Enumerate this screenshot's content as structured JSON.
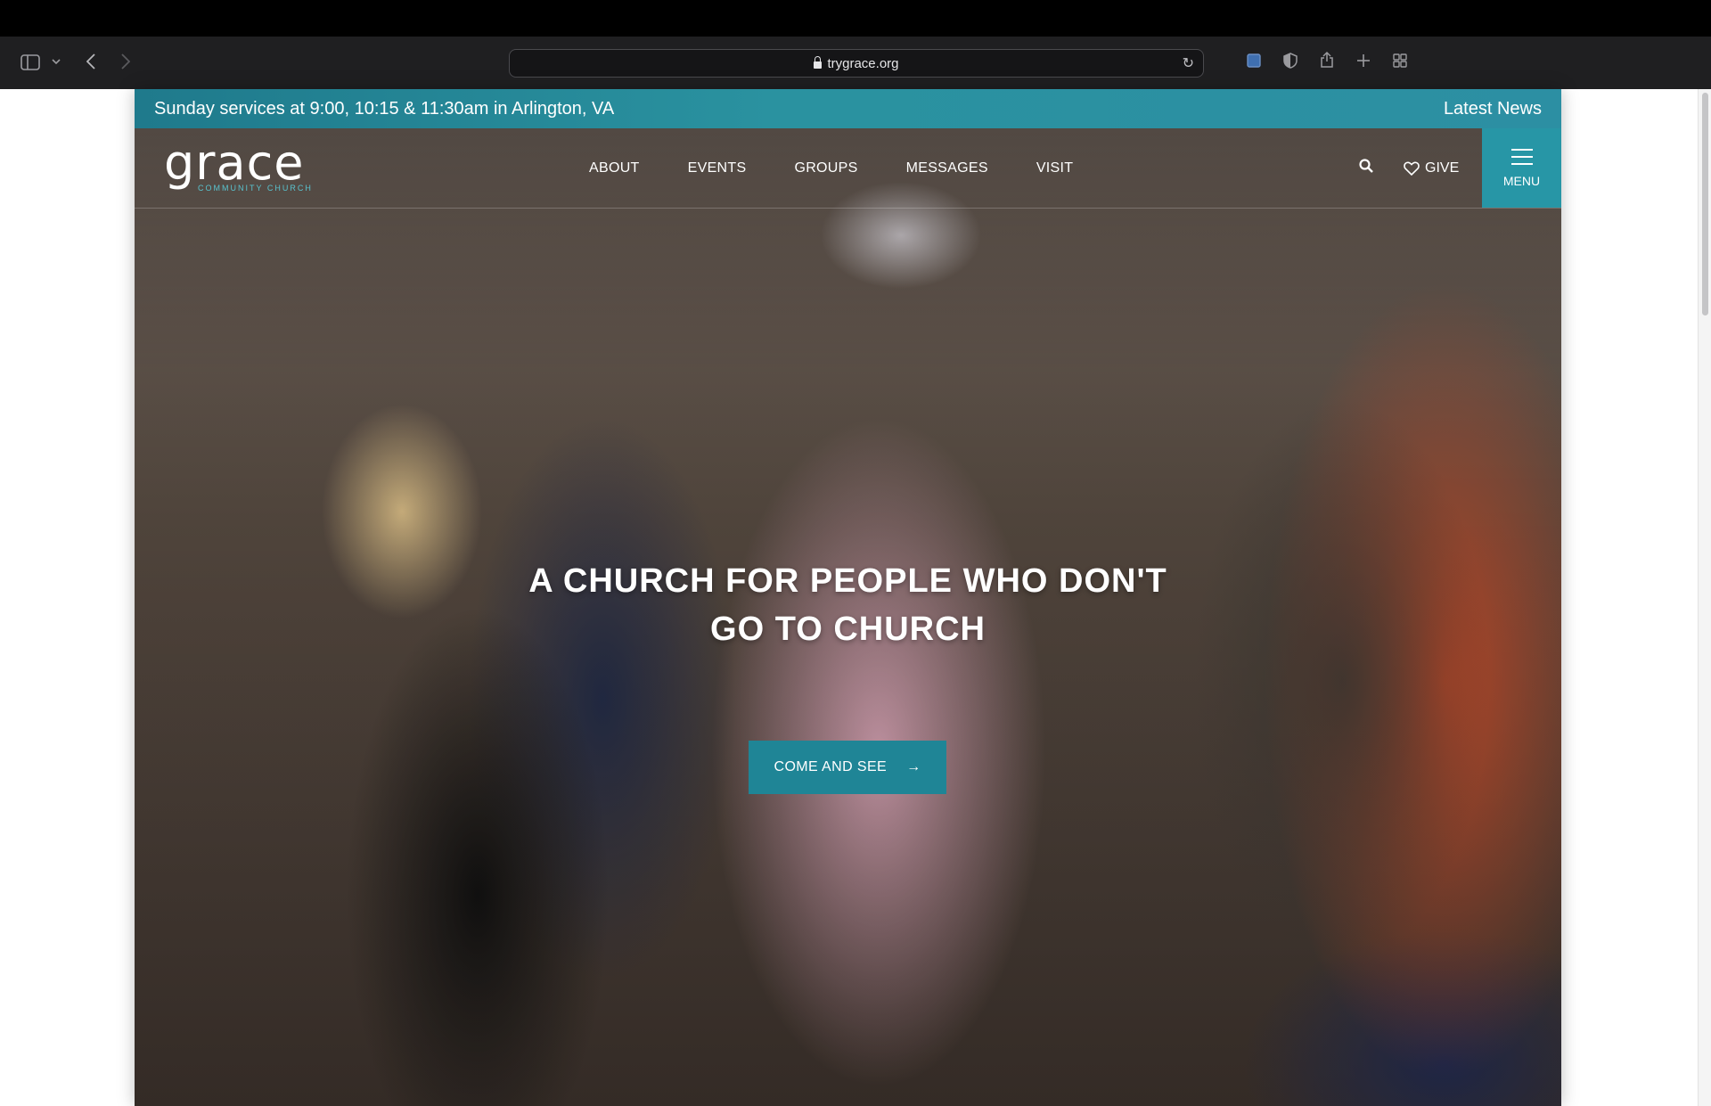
{
  "browser": {
    "url": "trygrace.org"
  },
  "announcement": {
    "services": "Sunday services at 9:00, 10:15 & 11:30am in Arlington, VA",
    "latest_news": "Latest News"
  },
  "site": {
    "logo_word": "grace",
    "logo_sub": "COMMUNITY CHURCH",
    "nav": [
      {
        "label": "ABOUT"
      },
      {
        "label": "EVENTS"
      },
      {
        "label": "GROUPS"
      },
      {
        "label": "MESSAGES"
      },
      {
        "label": "VISIT"
      }
    ],
    "give_label": "GIVE",
    "menu_label": "MENU"
  },
  "hero": {
    "headline_line1": "A CHURCH FOR PEOPLE WHO DON'T",
    "headline_line2": "GO TO CHURCH",
    "cta_label": "COME AND SEE",
    "cta_arrow": "→"
  },
  "colors": {
    "accent": "#2796a6",
    "cta": "#1f8596",
    "logo_sub": "#59c3cf"
  },
  "icons": [
    "sidebar-icon",
    "chevron-down-icon",
    "back-icon",
    "forward-icon",
    "lock-icon",
    "reload-icon",
    "tab-overview-icon",
    "privacy-icon",
    "share-icon",
    "new-tab-icon",
    "grid-icon",
    "search-icon",
    "heart-icon",
    "hamburger-icon",
    "arrow-right-icon"
  ]
}
